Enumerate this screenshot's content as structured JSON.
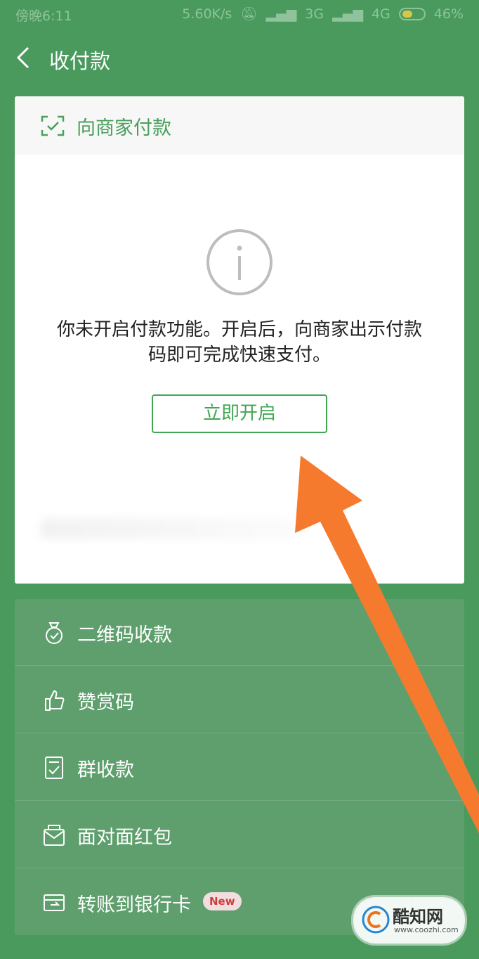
{
  "status_bar": {
    "time": "傍晚6:11",
    "speed": "5.60K/s",
    "network1": "3G",
    "network2": "4G",
    "battery": "46%"
  },
  "header": {
    "title": "收付款"
  },
  "pay_card": {
    "title": "向商家付款",
    "message_line1": "你未开启付款功能。开启后，向商家出示付款",
    "message_line2": "码即可完成快速支付。",
    "enable_button": "立即开启"
  },
  "menu": {
    "items": [
      {
        "label": "二维码收款",
        "icon": "money-bag-icon"
      },
      {
        "label": "赞赏码",
        "icon": "thumbs-up-icon"
      },
      {
        "label": "群收款",
        "icon": "group-collect-icon"
      },
      {
        "label": "面对面红包",
        "icon": "red-packet-icon"
      },
      {
        "label": "转账到银行卡",
        "icon": "bank-transfer-icon",
        "badge": "New"
      }
    ]
  },
  "watermark": {
    "title": "酷知网",
    "url": "www.coozhi.com"
  },
  "colors": {
    "background": "#4a9a5e",
    "accent": "#41a654",
    "arrow": "#f57a2e"
  }
}
